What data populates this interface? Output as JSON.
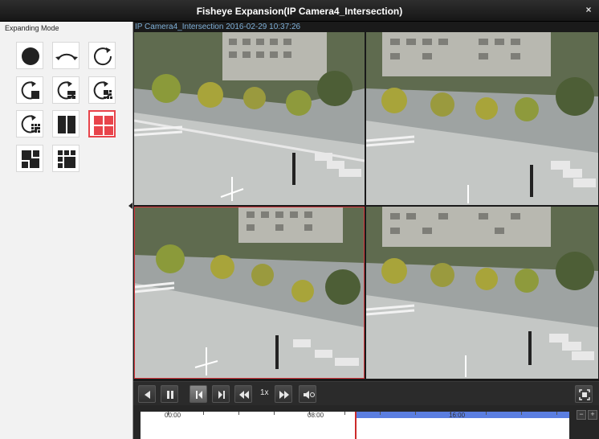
{
  "window": {
    "title": "Fisheye Expansion(IP Camera4_Intersection)",
    "close_glyph": "×"
  },
  "left_panel": {
    "label": "Expanding Mode",
    "modes": [
      {
        "name": "fisheye-mode-icon"
      },
      {
        "name": "panorama-180-icon"
      },
      {
        "name": "panorama-360-icon"
      },
      {
        "name": "panorama-1-ptz-icon"
      },
      {
        "name": "panorama-3-ptz-icon"
      },
      {
        "name": "panorama-6-ptz-icon"
      },
      {
        "name": "panorama-8-ptz-icon"
      },
      {
        "name": "dual-180-icon"
      },
      {
        "name": "four-ptz-icon",
        "selected": true
      },
      {
        "name": "fisheye-3-ptz-icon"
      },
      {
        "name": "fisheye-8-ptz-icon"
      }
    ]
  },
  "video": {
    "overlay": "IP Camera4_Intersection   2016-02-29 10:37:26"
  },
  "controls": {
    "speed": "1x"
  },
  "timeline": {
    "labels": [
      "00:00",
      "08:00",
      "16:00"
    ],
    "zoom_out": "−",
    "zoom_in": "+",
    "playhead_fraction": 0.5,
    "recorded_from_fraction": 0.5
  },
  "colors": {
    "accent_selected": "#e8444b",
    "timeline_record": "#5b7ee0",
    "playhead": "#cc2b2b"
  }
}
